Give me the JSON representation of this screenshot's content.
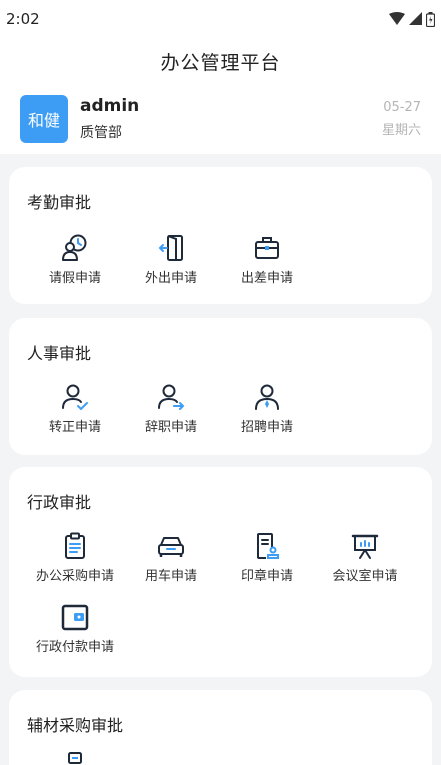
{
  "status": {
    "time": "2:02"
  },
  "header": {
    "title": "办公管理平台"
  },
  "user": {
    "avatar_text": "和健",
    "name": "admin",
    "department": "质管部",
    "date": "05-27",
    "weekday": "星期六"
  },
  "colors": {
    "accent": "#3d9cf3",
    "icon_dark": "#1e2a3a",
    "icon_blue": "#3d9cf3",
    "background": "#f3f4f6"
  },
  "sections": [
    {
      "title": "考勤审批",
      "items": [
        {
          "label": "请假申请",
          "icon": "leave-clock-icon"
        },
        {
          "label": "外出申请",
          "icon": "door-exit-icon"
        },
        {
          "label": "出差申请",
          "icon": "briefcase-icon"
        }
      ]
    },
    {
      "title": "人事审批",
      "items": [
        {
          "label": "转正申请",
          "icon": "user-check-icon"
        },
        {
          "label": "辞职申请",
          "icon": "user-leave-icon"
        },
        {
          "label": "招聘申请",
          "icon": "user-tie-icon"
        }
      ]
    },
    {
      "title": "行政审批",
      "items": [
        {
          "label": "办公采购申请",
          "icon": "clipboard-icon"
        },
        {
          "label": "用车申请",
          "icon": "car-icon"
        },
        {
          "label": "印章申请",
          "icon": "seal-document-icon"
        },
        {
          "label": "会议室申请",
          "icon": "presentation-icon"
        },
        {
          "label": "行政付款申请",
          "icon": "wallet-icon"
        }
      ]
    },
    {
      "title": "辅材采购审批",
      "items": [
        {
          "label": "",
          "icon": "purchase-icon"
        }
      ]
    }
  ]
}
